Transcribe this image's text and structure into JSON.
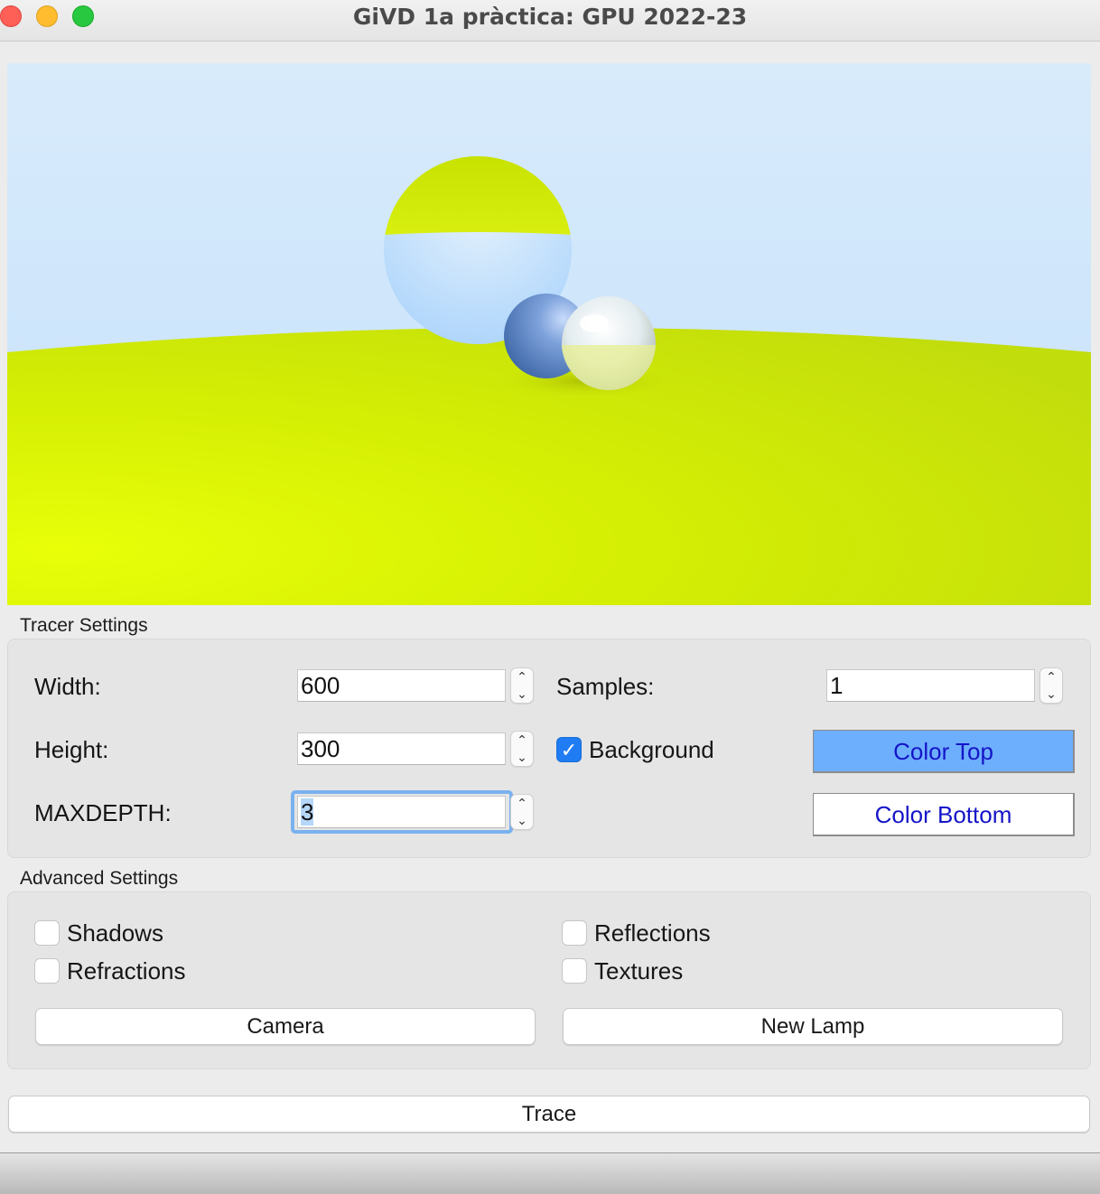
{
  "window": {
    "title": "GiVD 1a pràctica: GPU 2022-23"
  },
  "render": {
    "sky_color_top": "#d6e9fb",
    "sky_color_bottom": "#b7d9fb",
    "ground_color": "#d4ec05",
    "objects": [
      "large-sphere-yellow-blue",
      "small-blue-sphere",
      "small-metallic-sphere",
      "ground-plane"
    ]
  },
  "tracer_settings": {
    "title": "Tracer Settings",
    "width_label": "Width:",
    "width_value": "600",
    "height_label": "Height:",
    "height_value": "300",
    "maxdepth_label": "MAXDEPTH:",
    "maxdepth_value": "3",
    "samples_label": "Samples:",
    "samples_value": "1",
    "background_label": "Background",
    "background_checked": true,
    "color_top_label": "Color Top",
    "color_top_bg": "#6eaffd",
    "color_bottom_label": "Color Bottom",
    "color_bottom_bg": "#ffffff"
  },
  "advanced_settings": {
    "title": "Advanced Settings",
    "shadows_label": "Shadows",
    "shadows_checked": false,
    "reflections_label": "Reflections",
    "reflections_checked": false,
    "refractions_label": "Refractions",
    "refractions_checked": false,
    "textures_label": "Textures",
    "textures_checked": false,
    "camera_label": "Camera",
    "new_lamp_label": "New Lamp"
  },
  "trace_label": "Trace"
}
